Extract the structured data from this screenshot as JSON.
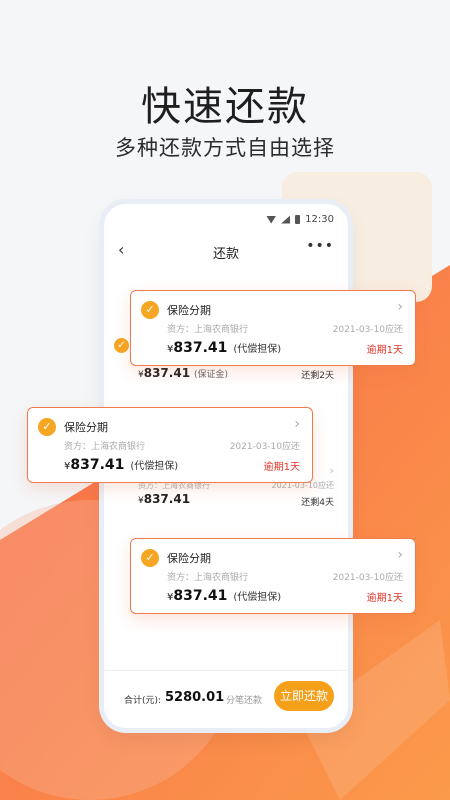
{
  "hero": {
    "title": "快速还款",
    "subtitle": "多种还款方式自由选择"
  },
  "status_bar": {
    "time": "12:30"
  },
  "nav": {
    "back_icon": "chevron-left-icon",
    "title": "还款",
    "more_icon": "more-dots-icon"
  },
  "background_list": [
    {
      "amount_currency": "¥",
      "amount": "837.41",
      "note": "(保证金)",
      "remaining": "还剩2天"
    },
    {
      "lender": "资方：上海农商银行",
      "due": "2021-03-10应还",
      "amount_currency": "¥",
      "amount": "837.41",
      "remaining": "还剩4天"
    }
  ],
  "cards": [
    {
      "title": "保险分期",
      "lender": "资方：上海农商银行",
      "due": "2021-03-10应还",
      "currency": "¥",
      "amount": "837.41",
      "note": "(代偿担保)",
      "status": "逾期1天"
    },
    {
      "title": "保险分期",
      "lender": "资方：上海农商银行",
      "due": "2021-03-10应还",
      "currency": "¥",
      "amount": "837.41",
      "note": "(代偿担保)",
      "status": "逾期1天"
    },
    {
      "title": "保险分期",
      "lender": "资方：上海农商银行",
      "due": "2021-03-10应还",
      "currency": "¥",
      "amount": "837.41",
      "note": "(代偿担保)",
      "status": "逾期1天"
    }
  ],
  "footer": {
    "total_label": "合计(元):",
    "total_value": "5280.01",
    "split_label": "分笔还款",
    "pay_label": "立即还款"
  },
  "colors": {
    "accent_orange": "#f5a01a",
    "card_border": "#f07b4d",
    "overdue_red": "#e5332a",
    "check_orange": "#f5a623"
  }
}
